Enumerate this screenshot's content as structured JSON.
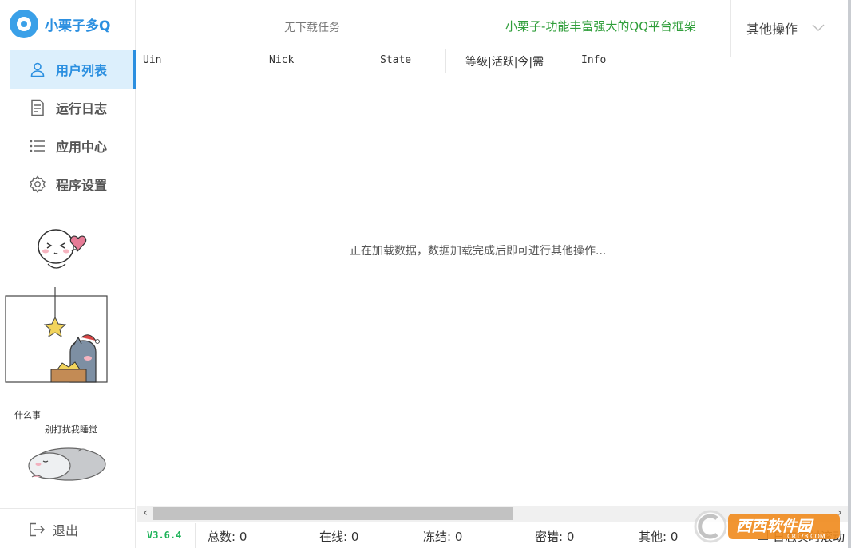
{
  "app": {
    "name": "小栗子多Q"
  },
  "header": {
    "download_status": "无下载任务",
    "slogan": "小栗子-功能丰富强大的QQ平台框架",
    "other_ops": "其他操作"
  },
  "sidebar": {
    "items": [
      {
        "label": "用户列表",
        "icon": "user-icon",
        "active": true
      },
      {
        "label": "运行日志",
        "icon": "document-icon",
        "active": false
      },
      {
        "label": "应用中心",
        "icon": "list-icon",
        "active": false
      },
      {
        "label": "程序设置",
        "icon": "gear-icon",
        "active": false
      }
    ],
    "sticker_text_1": "什么事",
    "sticker_text_2": "别打扰我睡觉",
    "logout": "退出"
  },
  "table": {
    "columns": [
      "Uin",
      "Nick",
      "State",
      "等级|活跃|今|需",
      "Info"
    ],
    "loading_text": "正在加载数据，数据加载完成后即可进行其他操作..."
  },
  "statusbar": {
    "version": "V3.6.4",
    "total": "总数: 0",
    "online": "在线: 0",
    "frozen": "冻结: 0",
    "pwd_error": "密错: 0",
    "other": "其他: 0",
    "log_scroll": "日志实时滚动"
  },
  "watermark": {
    "text": "西西软件园",
    "sub": "CR173.COM"
  },
  "colors": {
    "accent": "#2b8fe0",
    "slogan": "#2f9e3a",
    "version": "#1fb35a"
  }
}
